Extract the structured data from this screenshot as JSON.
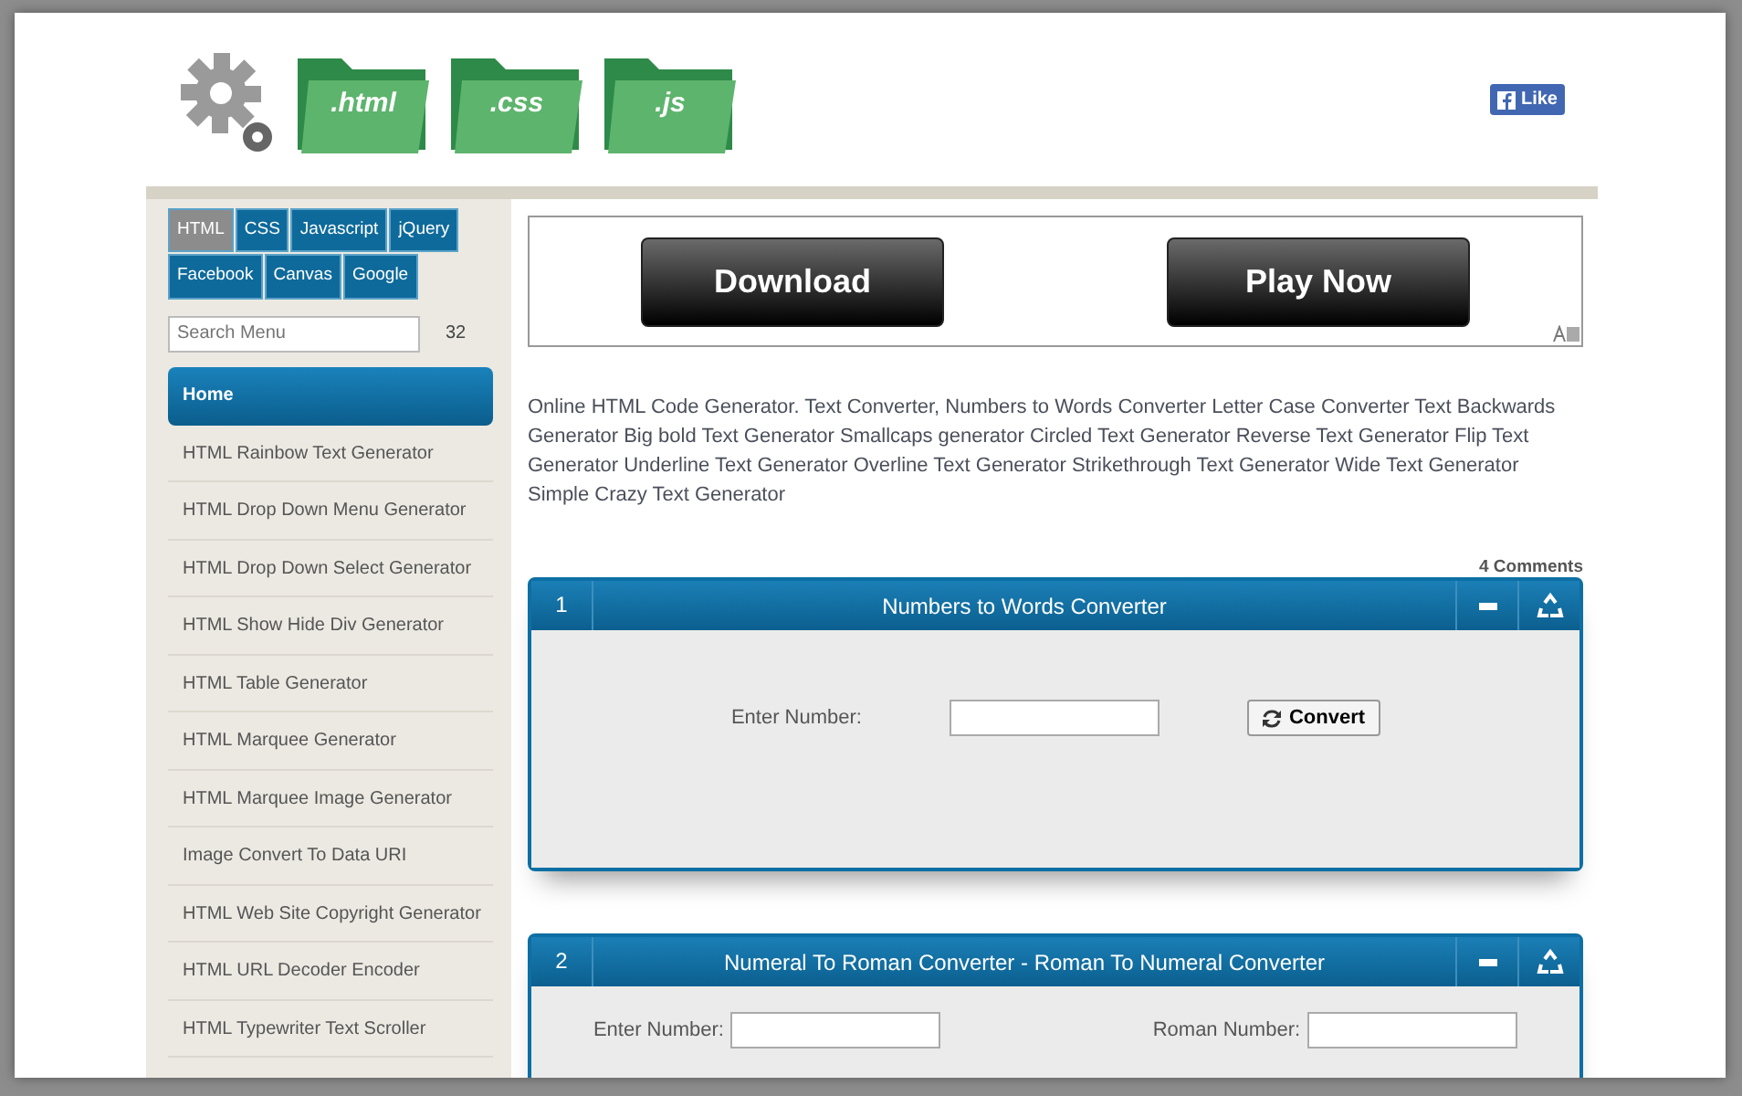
{
  "header": {
    "logo_folders": [
      ".html",
      ".css",
      ".js"
    ],
    "like_button": "Like"
  },
  "sidebar": {
    "tabs": [
      {
        "label": "HTML",
        "selected": true
      },
      {
        "label": "CSS",
        "selected": false
      },
      {
        "label": "Javascript",
        "selected": false
      },
      {
        "label": "jQuery",
        "selected": false
      },
      {
        "label": "Facebook",
        "selected": false
      },
      {
        "label": "Canvas",
        "selected": false
      },
      {
        "label": "Google",
        "selected": false
      }
    ],
    "search": {
      "placeholder": "Search Menu"
    },
    "count": "32",
    "items": [
      {
        "label": "Home",
        "selected": true
      },
      {
        "label": "HTML Rainbow Text Generator",
        "selected": false
      },
      {
        "label": "HTML Drop Down Menu Generator",
        "selected": false
      },
      {
        "label": "HTML Drop Down Select Generator",
        "selected": false
      },
      {
        "label": "HTML Show Hide Div Generator",
        "selected": false
      },
      {
        "label": "HTML Table Generator",
        "selected": false
      },
      {
        "label": "HTML Marquee Generator",
        "selected": false
      },
      {
        "label": "HTML Marquee Image Generator",
        "selected": false
      },
      {
        "label": "Image Convert To Data URI",
        "selected": false
      },
      {
        "label": "HTML Web Site Copyright Generator",
        "selected": false
      },
      {
        "label": "HTML URL Decoder Encoder",
        "selected": false
      },
      {
        "label": "HTML Typewriter Text Scroller",
        "selected": false
      }
    ]
  },
  "ad": {
    "buttons": [
      "Download",
      "Play Now"
    ]
  },
  "intro": "Online HTML Code Generator. Text Converter, Numbers to Words Converter Letter Case Converter Text Backwards Generator Big bold Text Generator Smallcaps generator Circled Text Generator Reverse Text Generator Flip Text Generator Underline Text Generator Overline Text Generator Strikethrough Text Generator Wide Text Generator Simple Crazy Text Generator",
  "comments": "4 Comments",
  "panels": [
    {
      "number": "1",
      "title": "Numbers to Words Converter",
      "fields": [
        {
          "label": "Enter Number:"
        }
      ],
      "button": "Convert"
    },
    {
      "number": "2",
      "title": "Numeral To Roman Converter - Roman To Numeral Converter",
      "fields": [
        {
          "label": "Enter Number:"
        },
        {
          "label": "Roman Number:"
        }
      ]
    }
  ]
}
